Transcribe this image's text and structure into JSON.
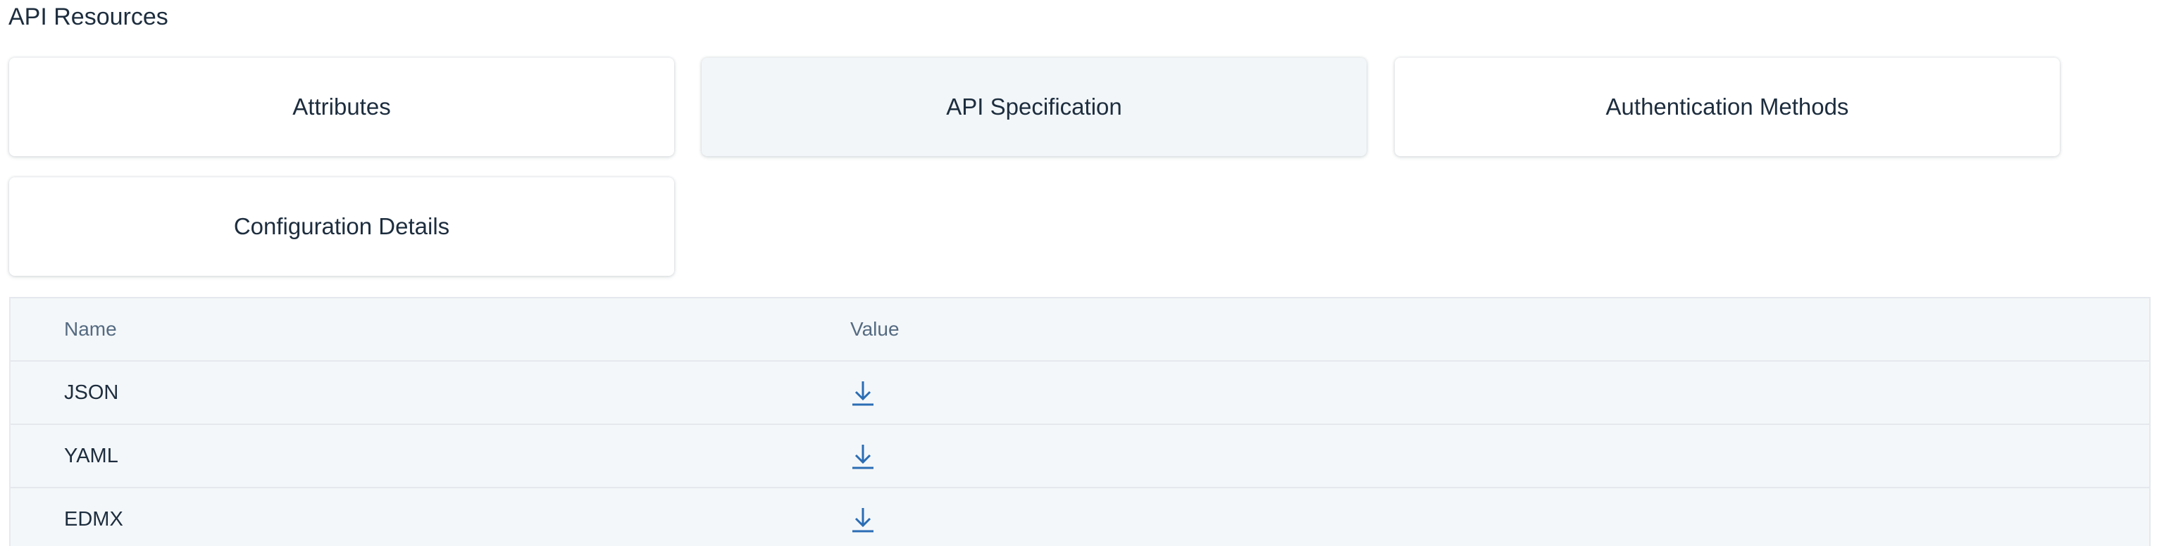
{
  "section": {
    "title": "API Resources"
  },
  "tiles": [
    {
      "label": "Attributes",
      "selected": false
    },
    {
      "label": "API Specification",
      "selected": true
    },
    {
      "label": "Authentication Methods",
      "selected": false
    },
    {
      "label": "Configuration Details",
      "selected": false
    }
  ],
  "table": {
    "columns": {
      "name": "Name",
      "value": "Value"
    },
    "rows": [
      {
        "name": "JSON",
        "value_icon": "download-icon"
      },
      {
        "name": "YAML",
        "value_icon": "download-icon"
      },
      {
        "name": "EDMX",
        "value_icon": "download-icon"
      }
    ]
  },
  "colors": {
    "accent": "#0a6ed1",
    "icon": "#2a6db5",
    "selected_tile_bg": "#f2f6f9",
    "table_bg": "#f4f7f9"
  }
}
